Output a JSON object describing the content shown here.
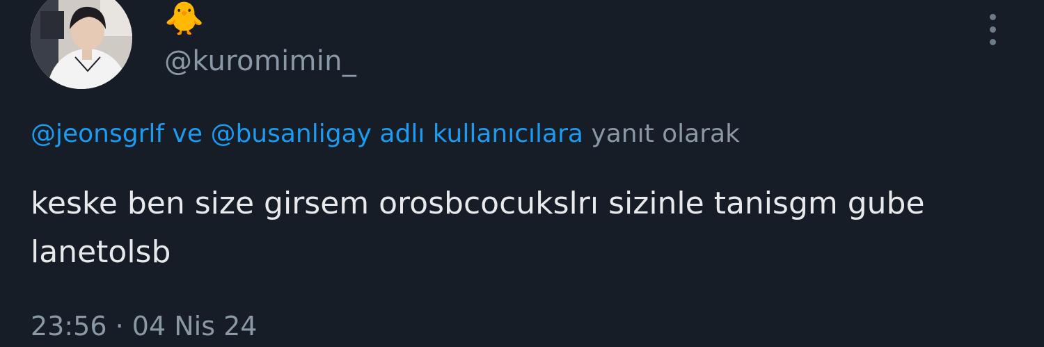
{
  "author": {
    "display_name": "🐥",
    "handle": "@kuromimin_",
    "avatar_icon": "profile-photo"
  },
  "menu": {
    "icon": "more-vertical-icon"
  },
  "reply_context": {
    "mention_1": "@jeonsgrlf",
    "connector": "ve",
    "mention_2": "@busanligay",
    "link_text": "adlı kullanıcılara",
    "suffix": "yanıt olarak"
  },
  "tweet": {
    "text": "keske ben size girsem orosbcocukslrı sizinle tanisgm gube lanetolsb",
    "time": "23:56",
    "separator": "·",
    "date": "04 Nis 24"
  },
  "colors": {
    "background": "#161d27",
    "text": "#e7e9ea",
    "muted": "#8b98a5",
    "link": "#1d9bf0"
  }
}
